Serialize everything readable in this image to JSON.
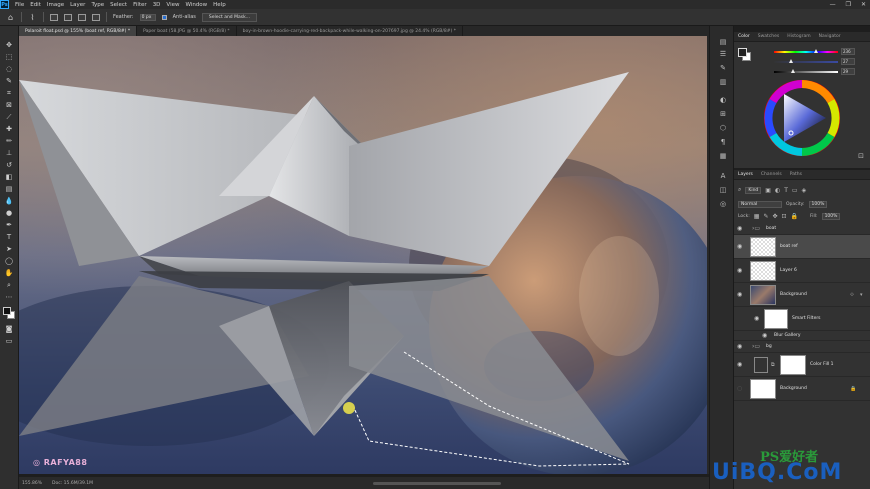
{
  "app": {
    "logo": "Ps"
  },
  "menu": [
    "File",
    "Edit",
    "Image",
    "Layer",
    "Type",
    "Select",
    "Filter",
    "3D",
    "View",
    "Window",
    "Help"
  ],
  "window_controls": {
    "minimize": "—",
    "maximize": "❐",
    "close": "✕"
  },
  "options_bar": {
    "feather_label": "Feather:",
    "feather_value": "0 px",
    "anti_alias_label": "Anti-alias",
    "select_mask_label": "Select and Mask..."
  },
  "tabs": [
    {
      "label": "Polaroit float.psd @ 155% (boat ref, RGB/8#) *",
      "active": true
    },
    {
      "label": "Paper boat (58.JPG @ 50.4% (RGB/8) *",
      "active": false
    },
    {
      "label": "boy-in-brown-hoodie-carrying-red-backpack-while-walking-on-207697.jpg @ 24.4% (RGB/8#) *",
      "active": false
    }
  ],
  "status": {
    "zoom": "155.86%",
    "doc_size": "Doc: 15.6M/39.1M"
  },
  "watermarks": {
    "author": "RAFYA88",
    "site_logo": "PS爱好者",
    "site_domain": "UiBQ.CoM"
  },
  "color_panel": {
    "tabs": [
      {
        "label": "Color",
        "active": true
      },
      {
        "label": "Swatches",
        "active": false
      },
      {
        "label": "Histogram",
        "active": false
      },
      {
        "label": "Navigator",
        "active": false
      }
    ],
    "sliders": [
      {
        "id": "h",
        "value": "236",
        "fraction": 0.66
      },
      {
        "id": "s",
        "value": "27",
        "fraction": 0.27
      },
      {
        "id": "b",
        "value": "29",
        "fraction": 0.29
      }
    ]
  },
  "layers_panel": {
    "tabs": [
      {
        "label": "Layers",
        "active": true
      },
      {
        "label": "Channels",
        "active": false
      },
      {
        "label": "Paths",
        "active": false
      }
    ],
    "filter_kind": "Kind",
    "blend_mode": "Normal",
    "opacity_label": "Opacity:",
    "opacity_value": "100%",
    "lock_label": "Lock:",
    "fill_label": "Fill:",
    "fill_value": "100%",
    "layers": [
      {
        "name": "boat",
        "type": "group",
        "visible": true,
        "selected": false
      },
      {
        "name": "boat ref",
        "type": "layer",
        "visible": true,
        "selected": true
      },
      {
        "name": "Layer 6",
        "type": "layer",
        "visible": true,
        "selected": false
      },
      {
        "name": "Background",
        "type": "smart",
        "visible": true,
        "selected": false
      },
      {
        "name": "Smart Filters",
        "type": "smart-filter",
        "visible": true,
        "selected": false
      },
      {
        "name": "Blur Gallery",
        "type": "filter",
        "visible": true,
        "selected": false
      },
      {
        "name": "bg",
        "type": "group",
        "visible": true,
        "selected": false
      },
      {
        "name": "Color Fill 1",
        "type": "fill",
        "visible": true,
        "selected": false
      },
      {
        "name": "Background",
        "type": "background",
        "visible": false,
        "selected": false
      }
    ]
  }
}
